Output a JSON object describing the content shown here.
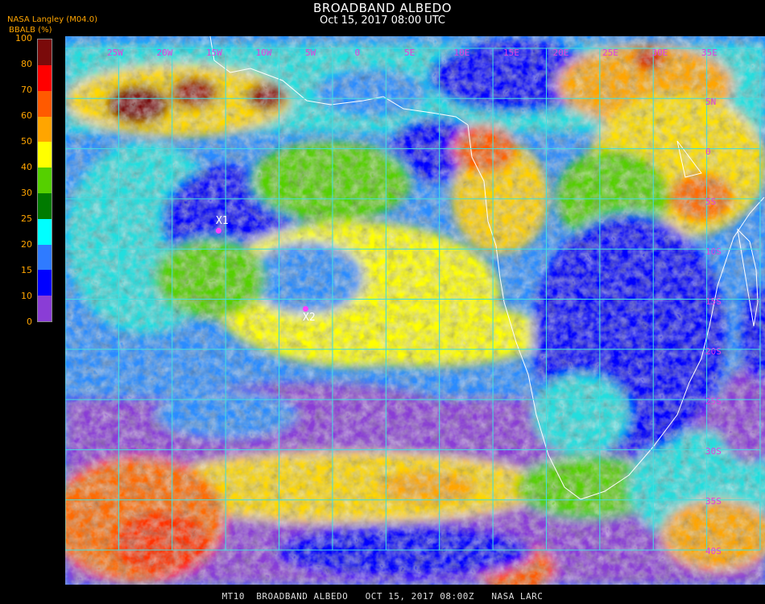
{
  "title": "BROADBAND ALBEDO",
  "subtitle": "Oct 15, 2017 08:00 UTC",
  "source_label": "NASA Langley (M04.0)",
  "legend": {
    "label": "BBALB (%)",
    "ticks": [
      "0",
      "10",
      "15",
      "20",
      "25",
      "30",
      "40",
      "50",
      "60",
      "70",
      "80",
      "100"
    ],
    "colors": [
      "#8a3dd6",
      "#0000ff",
      "#2f7bff",
      "#00ffff",
      "#007a00",
      "#55d000",
      "#ffff00",
      "#ffa500",
      "#ff5a00",
      "#ff0000",
      "#7a0a0a"
    ]
  },
  "map": {
    "lon_labels": [
      "25W",
      "20W",
      "15W",
      "10W",
      "5W",
      "0",
      "5E",
      "10E",
      "15E",
      "20E",
      "25E",
      "30E",
      "35E"
    ],
    "lat_labels": [
      "5N",
      "0",
      "5S",
      "10S",
      "15S",
      "20S",
      "25S",
      "30S",
      "35S",
      "40S"
    ],
    "markers": [
      {
        "label": "X1"
      },
      {
        "label": "X2"
      }
    ],
    "grid_color": "#3fe0e0",
    "coast_color": "#ffffff"
  },
  "footer": "MT10  BROADBAND ALBEDO   OCT 15, 2017 08:00Z   NASA LARC"
}
